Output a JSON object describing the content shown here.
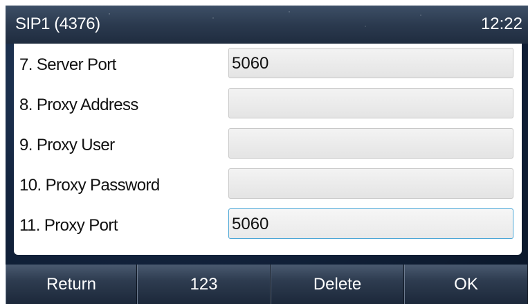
{
  "header": {
    "title": "SIP1 (4376)",
    "time": "12:22"
  },
  "rows": [
    {
      "label": "7.  Server Port",
      "value": "5060"
    },
    {
      "label": "8.  Proxy Address",
      "value": ""
    },
    {
      "label": "9.  Proxy User",
      "value": ""
    },
    {
      "label": "10. Proxy Password",
      "value": ""
    },
    {
      "label": "11.  Proxy Port",
      "value": "5060"
    }
  ],
  "softkeys": {
    "return": "Return",
    "input_mode": "123",
    "delete": "Delete",
    "ok": "OK"
  },
  "colors": {
    "focus_border": "#4aa6d6",
    "softkey_bg": "#2e3c50"
  }
}
